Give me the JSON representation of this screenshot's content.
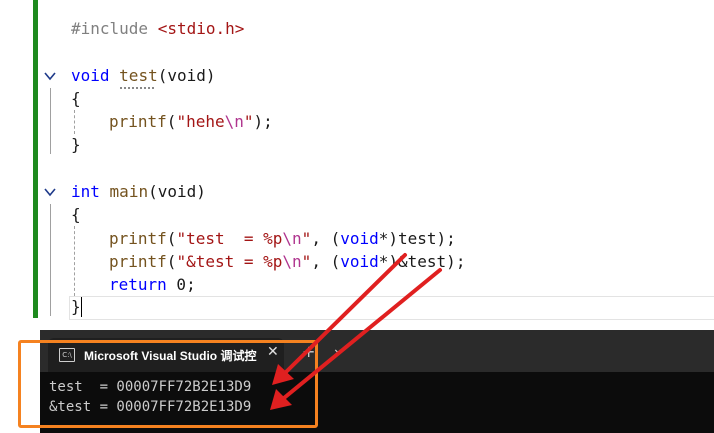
{
  "editor": {
    "lines": {
      "include_directive": "#include",
      "include_header": "<stdio.h>",
      "test_decl_type": "void",
      "test_decl_name": "test",
      "test_decl_params": "(void)",
      "open_brace_1": "{",
      "printf_hehe_fn": "printf",
      "printf_hehe_paren": "(",
      "printf_hehe_str": "\"hehe",
      "printf_hehe_esc": "\\n",
      "printf_hehe_end_str": "\"",
      "printf_hehe_tail": ");",
      "close_brace_1": "}",
      "main_type": "int",
      "main_name": "main",
      "main_params": "(void)",
      "open_brace_2": "{",
      "p1_fn": "printf",
      "p1_paren": "(",
      "p1_str": "\"test  = %p",
      "p1_esc": "\\n",
      "p1_strend": "\"",
      "p1_comma": ", (",
      "p1_void": "void",
      "p1_cast": "*)test);",
      "p2_fn": "printf",
      "p2_paren": "(",
      "p2_str": "\"&test = %p",
      "p2_esc": "\\n",
      "p2_strend": "\"",
      "p2_comma": ", (",
      "p2_void": "void",
      "p2_cast": "*)&test);",
      "return_kw": "return",
      "return_val": " 0;",
      "close_brace_2": "}"
    }
  },
  "console": {
    "tab_title": "Microsoft Visual Studio 调试控",
    "tab_icon_text": "C:\\",
    "close_glyph": "✕",
    "add_glyph": "+",
    "dropdown_glyph": "⌄",
    "output": [
      "test  = 00007FF72B2E13D9",
      "&test = 00007FF72B2E13D9"
    ]
  },
  "colors": {
    "annotation_box": "#f58220",
    "annotation_arrow": "#e02020",
    "change_bar": "#1e8a1e"
  },
  "icons": [
    "fold-chevron-icon",
    "console-app-icon",
    "close-icon",
    "add-tab-icon",
    "dropdown-icon"
  ]
}
